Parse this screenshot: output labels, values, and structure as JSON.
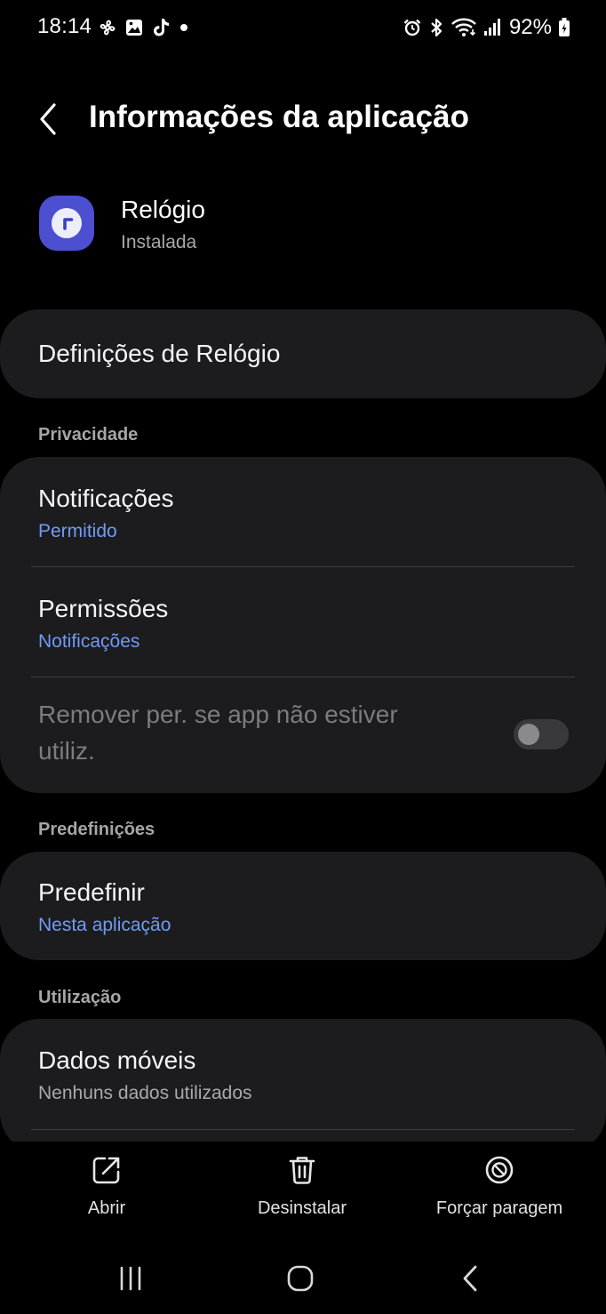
{
  "status_bar": {
    "time": "18:14",
    "battery": "92%",
    "left_icons": [
      "pinwheel-icon",
      "gallery-icon",
      "tiktok-icon",
      "dot-icon"
    ],
    "right_icons": [
      "alarm-icon",
      "bluetooth-icon",
      "wifi-icon",
      "signal-icon",
      "battery-icon"
    ]
  },
  "header": {
    "title": "Informações da aplicação"
  },
  "app": {
    "name": "Relógio",
    "status": "Instalada",
    "icon_color": "#4b4fd0"
  },
  "settings_link": {
    "label": "Definições de Relógio"
  },
  "sections": {
    "privacy": {
      "header": "Privacidade",
      "notifications": {
        "title": "Notificações",
        "value": "Permitido"
      },
      "permissions": {
        "title": "Permissões",
        "value": "Notificações"
      },
      "remove_permissions": {
        "label": "Remover per. se app não estiver utiliz.",
        "enabled": false
      }
    },
    "defaults": {
      "header": "Predefinições",
      "set_default": {
        "title": "Predefinir",
        "value": "Nesta aplicação"
      }
    },
    "usage": {
      "header": "Utilização",
      "mobile_data": {
        "title": "Dados móveis",
        "value": "Nenhuns dados utilizados"
      }
    }
  },
  "actions": {
    "open": "Abrir",
    "uninstall": "Desinstalar",
    "force_stop": "Forçar paragem"
  },
  "colors": {
    "accent_link": "#6f9bf5",
    "card_background": "#1c1c1e",
    "background": "#000000"
  }
}
